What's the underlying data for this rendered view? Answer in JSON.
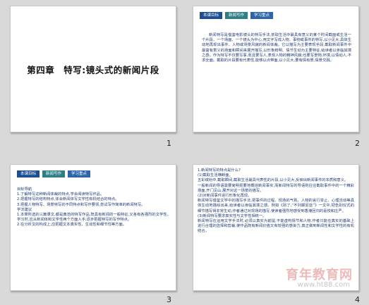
{
  "slides": [
    {
      "number": "1",
      "title": "第四章　特写:镜头式的新闻片段"
    },
    {
      "number": "2",
      "tabs": [
        "本课目标",
        "新闻写作",
        "学习重点"
      ],
      "paragraph": "新闻特写是借鉴电影镜头的特写手法,抓取生活中最具有意义的某个时间截面或生活一个片段、一个场面、一个镜头为中心,用文字写成人物、事物或事件的特写,以小见大,具体生动地再现出事件、人物或场景风貌的新闻体裁。它以描写为主要表现手段,截取新闻事件中最富有意义的场面和瞬间来展开描写,以形象鲜明、情节生动为主要特征,给读者以身临其境之感。作为特写不仅要写事,而且要写人,表现人物的精神风貌;也要写景物,环境,以情动人,不求全面。截取的片段要有代表性,能够以点带面,以小见大,要有情有景,情景交融。"
    },
    {
      "number": "3",
      "tabs": [
        "本课目标",
        "新闻写作",
        "学习重点"
      ],
      "lines": [
        "目标导航",
        "1.了解特写这种新闻体裁的特点,学会阅读特写作品。",
        "2.把握特写的结构特点,体会新闻体写文学性有机结合的特点。",
        "3.把握人物特写、场景特写的不同特点和写作要领,尝试写作简单的新闻特写。",
        "学法建议",
        "1.本章所选的三篇课文,都是典范的特写作品,既具有新闻的一般特征,又各有各强烈的文学性。学习时,应从新闻体和文学性两个方面入手,逐步把握特写的写作特点。",
        "2.在分析文的构成上,应把握文本真实性、生动性和细节性等方面。"
      ]
    },
    {
      "number": "4",
      "lines": [
        "1.新闻特写的特点是什么?",
        "(1)截取生活横断面。",
        "五彩缤纷中,截取瞬间,截取生活最具代表性的片段,以小见大,反映出新闻事件的本质和意义。",
        "一般新闻的导语需要简明扼要地概括新闻事实,而新闻特写的导语则往往截取事件中的一个精彩场面,开门见山,展开对这一场景的描写。",
        "(2)对新闻事件进行形象化再现。",
        "新闻特写借鉴文学中的描写手法,把事件的过程、现场的气氛、人物的言行举止、心理活动等具体生动地描绘出来,给读者以身临其境之感。例如《别了,“不列颠尼亚”》一文中,把告别仪式的细节描写得非常生动,作者通过对现场的描写,使读者强烈地感受到香港回归的喜悦和庄严。",
        "(3)新闻特写要求真实性与文学性相统一。",
        "新闻特写在运用文学手法时,必须以真实为前提,不能虚构情节和人物,作者只能在真实的基础上进行合理的选择和剪裁,使作品既有新闻价值又有较强的感染力,真正做到新闻性和文学性的有机结合。"
      ]
    }
  ],
  "watermark": {
    "text": "育年教育网",
    "url": "www.ht88.com"
  }
}
